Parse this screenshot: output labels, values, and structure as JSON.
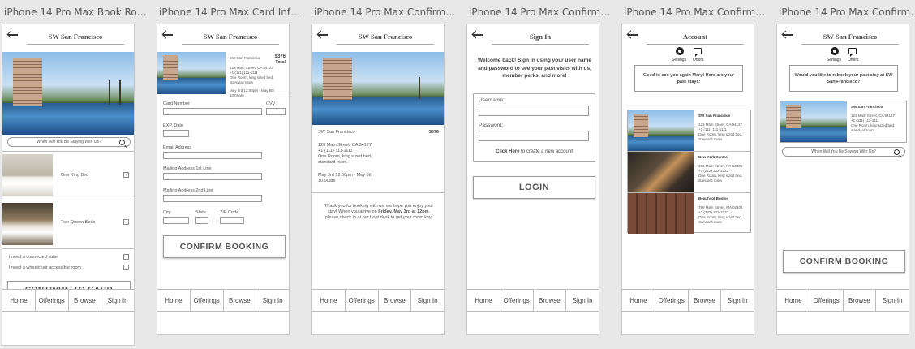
{
  "frames": [
    {
      "title": "iPhone 14 Pro Max Book Room ..."
    },
    {
      "title": "iPhone 14 Pro Max Card Inform..."
    },
    {
      "title": "iPhone 14 Pro Max Confirmatio..."
    },
    {
      "title": "iPhone 14 Pro Max Confirmatio..."
    },
    {
      "title": "iPhone 14 Pro Max Confirmatio..."
    },
    {
      "title": "iPhone 14 Pro Max Confirmatio..."
    }
  ],
  "nav": {
    "home": "Home",
    "offerings": "Offerings",
    "browse": "Browse",
    "signin": "Sign In"
  },
  "hotel_name": "SW San Francisco",
  "book": {
    "search_placeholder": "When Will You Be Staying With Us?",
    "room1": "One King Bed",
    "room2": "Two Queen Beds",
    "opt1": "I need a connected suite",
    "opt2": "I need a wheelchair accessible room",
    "continue": "CONTINUE TO CARD"
  },
  "card": {
    "hotel": "SW San Francisco",
    "price": "$376",
    "total": "Total",
    "address": "123 Main Street, CA 94127",
    "phone": "+1 (111) 111-1111",
    "room_desc": "One Room, king sized bed, standard room",
    "dates": "May 3rd 12:00pm - May 6th 10:00am",
    "card_number": "Card Number",
    "cvv": "CVV",
    "exp": "EXP. Date",
    "email": "Email Address",
    "addr1": "Mailing Address 1st Line",
    "addr2": "Mailing Address 2nd Line",
    "city": "City",
    "state": "State",
    "zip": "ZIP Code",
    "confirm": "CONFIRM BOOKING"
  },
  "confirm": {
    "hotel": "SW San Francisco",
    "price": "$376",
    "address": "123 Main Street, CA 94127",
    "phone": "+1 (111) 111-1111",
    "room_desc": "One Room, king sized bed, standard room.",
    "dates": "May 3rd 12:00pm - May 6th 10:00am",
    "thanks_pre": "Thank you for booking with us, we hope you enjoy your stay! When you arrive on ",
    "thanks_date": "Friday, May 3rd at 12pm",
    "thanks_post": ", please check in at our front desk to get your room key."
  },
  "signin": {
    "title": "Sign In",
    "welcome": "Welcome back! Sign in using your user name and password to see your past visits with us, member perks, and more!",
    "username": "Username:",
    "password": "Password:",
    "click_here": "Click Here",
    "create_account": " to create a new account",
    "login": "LOGIN"
  },
  "account": {
    "title": "Account",
    "settings": "Settings",
    "offers": "Offers",
    "greeting": "Good to see you again Mary! Here are your past stays:",
    "stays": [
      {
        "name": "SW San Francisco",
        "address": "123 Main Street, CA 94127",
        "phone": "+1 (111) 111-1111",
        "desc": "One Room, king sized bed, standard room"
      },
      {
        "name": "New York Central",
        "address": "456 Main Street, NY 10001",
        "phone": "+1 (222) 222-2222",
        "desc": "One Room, king sized bed, standard room"
      },
      {
        "name": "Beauty of Boston",
        "address": "789 Main Street, MA 02101",
        "phone": "+1 (333) 333-3333",
        "desc": "One Room, king sized bed, standard room"
      }
    ]
  },
  "rebook": {
    "hotel": "SW San Francisco",
    "settings": "Settings",
    "offers": "Offers",
    "question": "Would you like to rebook your past stay at SW San Francisco?",
    "stay_name": "SW San Francisco",
    "address": "123 Main Street, CA 94127",
    "phone": "+1 (111) 111-1111",
    "desc": "One Room, king sized bed, standard room",
    "search_placeholder": "When Will You Be Staying With Us?",
    "confirm": "CONFIRM BOOKING"
  }
}
